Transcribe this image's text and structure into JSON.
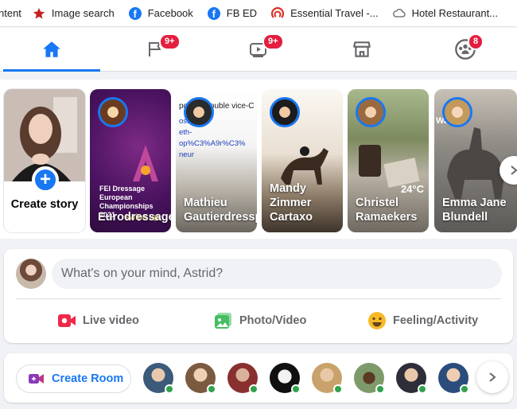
{
  "bookmarks": [
    {
      "label": "ntent",
      "icon": "page-icon"
    },
    {
      "label": "Image search",
      "icon": "star-icon"
    },
    {
      "label": "Facebook",
      "icon": "facebook-icon"
    },
    {
      "label": "FB ED",
      "icon": "facebook-icon"
    },
    {
      "label": "Essential Travel -...",
      "icon": "travel-logo-icon"
    },
    {
      "label": "Hotel Restaurant...",
      "icon": "cloud-icon"
    }
  ],
  "nav": {
    "tabs": [
      {
        "name": "home",
        "icon": "home-icon",
        "active": true,
        "badge": ""
      },
      {
        "name": "pages",
        "icon": "flag-icon",
        "active": false,
        "badge": "9+"
      },
      {
        "name": "watch",
        "icon": "video-icon",
        "active": false,
        "badge": "9+"
      },
      {
        "name": "marketplace",
        "icon": "store-icon",
        "active": false,
        "badge": ""
      },
      {
        "name": "groups",
        "icon": "groups-icon",
        "active": false,
        "badge": "8"
      }
    ],
    "accent": "#1877f2",
    "badge_color": "#e41e3f"
  },
  "stories": {
    "create_label": "Create story",
    "items": [
      {
        "name": "Eurodressage",
        "overlay": "FEI Dressage European Championships 2021",
        "swipe": "swipe up"
      },
      {
        "name": "Mathieu Gautierdressprod",
        "overlay": "pour la double vice-C"
      },
      {
        "name": "Mandy Zimmer Cartaxo",
        "overlay": ""
      },
      {
        "name": "Christel Ramaekers",
        "overlay": "24°C"
      },
      {
        "name": "Emma Jane Blundell",
        "overlay": "Wace!!"
      }
    ]
  },
  "composer": {
    "placeholder": "What's on your mind, Astrid?",
    "actions": [
      {
        "label": "Live video",
        "icon": "live-video-icon",
        "color": "#f02849"
      },
      {
        "label": "Photo/Video",
        "icon": "photo-icon",
        "color": "#45bd62"
      },
      {
        "label": "Feeling/Activity",
        "icon": "feeling-icon",
        "color": "#f7b928"
      }
    ]
  },
  "rooms": {
    "create_label": "Create Room",
    "contacts_count": 8,
    "online_color": "#31a24c"
  }
}
